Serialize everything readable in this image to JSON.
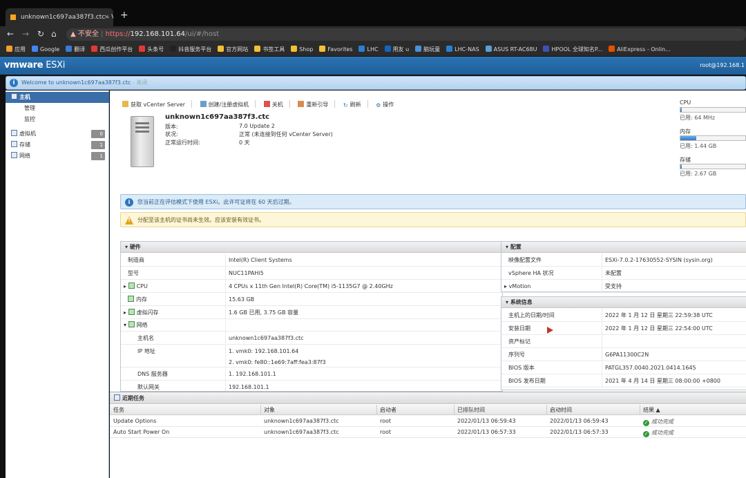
{
  "browser": {
    "tab_title": "unknown1c697aa387f3.ctc - V",
    "tab_close": "×",
    "new_tab": "+",
    "url_warning": "不安全",
    "url_proto": "https://",
    "url_host": "192.168.101.64",
    "url_path": "/ui/#/host",
    "bookmarks": [
      {
        "label": "应用",
        "color": "#f0a030"
      },
      {
        "label": "Google",
        "color": "#4285f4"
      },
      {
        "label": "翻译",
        "color": "#3a7bd5"
      },
      {
        "label": "西瓜创作平台",
        "color": "#e53935"
      },
      {
        "label": "头条号",
        "color": "#e53935"
      },
      {
        "label": "抖音服务平台",
        "color": "#222222"
      },
      {
        "label": "官方网站",
        "color": "#f2c037"
      },
      {
        "label": "书签工具",
        "color": "#f2c037"
      },
      {
        "label": "Shop",
        "color": "#f2c037"
      },
      {
        "label": "Favorites",
        "color": "#f2c037"
      },
      {
        "label": "LHC",
        "color": "#2a7fd4"
      },
      {
        "label": "用友 u",
        "color": "#1565c0"
      },
      {
        "label": "脑玩童",
        "color": "#4a90d9"
      },
      {
        "label": "LHC-NAS",
        "color": "#2a7fd4"
      },
      {
        "label": "ASUS RT-AC68U",
        "color": "#5aa0d8"
      },
      {
        "label": "HPOOL 全球知名P...",
        "color": "#3f51b5"
      },
      {
        "label": "AliExpress - Onlin...",
        "color": "#e65100"
      }
    ]
  },
  "esxi": {
    "logo_vm": "vmware",
    "logo_product": "ESXi",
    "user": "root@192.168.1",
    "welcome": "Welcome to unknown1c697aa387f3.ctc",
    "welcome_close": "- 关闭"
  },
  "sidebar": {
    "items": [
      {
        "label": "主机",
        "badge": ""
      },
      {
        "label": "管理",
        "badge": ""
      },
      {
        "label": "监控",
        "badge": ""
      },
      {
        "label": "虚拟机",
        "badge": "0"
      },
      {
        "label": "存储",
        "badge": "1"
      },
      {
        "label": "网络",
        "badge": "1"
      }
    ]
  },
  "toolbar": {
    "vcenter": "获取 vCenter Server",
    "create_vm": "创建/注册虚拟机",
    "shutdown": "关机",
    "reboot": "重新引导",
    "refresh": "刷新",
    "actions": "操作"
  },
  "host": {
    "name": "unknown1c697aa387f3.ctc",
    "version_label": "版本:",
    "version": "7.0 Update 2",
    "state_label": "状况:",
    "state": "正常 (未连接到任何 vCenter Server)",
    "uptime_label": "正常运行时间:",
    "uptime": "0 天"
  },
  "resources": {
    "cpu": {
      "label": "CPU",
      "used": "已用: 64 MHz",
      "fill": 0.02
    },
    "mem": {
      "label": "内存",
      "used": "已用: 1.44 GB",
      "fill": 0.24
    },
    "storage": {
      "label": "存储",
      "used": "已用: 2.67 GB",
      "fill": 0.02
    }
  },
  "alerts": {
    "eval": "您当前正在评估模式下使用 ESXi。此许可证将在 60 天后过期。",
    "cert": "分配至该主机的证书尚未生效。应该安装有效证书。"
  },
  "hardware": {
    "title": "硬件",
    "rows": [
      {
        "k": "制造商",
        "v": "Intel(R) Client Systems"
      },
      {
        "k": "型号",
        "v": "NUC11PAHi5"
      },
      {
        "k": "CPU",
        "v": "4 CPUs x 11th Gen Intel(R) Core(TM) i5-1135G7 @ 2.40GHz"
      },
      {
        "k": "内存",
        "v": "15.63 GB"
      },
      {
        "k": "虚拟闪存",
        "v": "1.6 GB 已用, 3.75 GB 容量"
      },
      {
        "k": "网络",
        "v": ""
      },
      {
        "k": "主机名",
        "v": "unknown1c697aa387f3.ctc"
      },
      {
        "k": "IP 地址",
        "v": "1. vmk0: 192.168.101.64"
      },
      {
        "k": "",
        "v": "2. vmk0: fe80::1e69:7aff:fea3:87f3"
      },
      {
        "k": "DNS 服务器",
        "v": "1. 192.168.101.1"
      },
      {
        "k": "默认网关",
        "v": "192.168.101.1"
      }
    ]
  },
  "config": {
    "title": "配置",
    "rows": [
      {
        "k": "映像配置文件",
        "v": "ESXi-7.0.2-17630552-SYSIN (sysin.org)"
      },
      {
        "k": "vSphere HA 状况",
        "v": "未配置"
      },
      {
        "k": "vMotion",
        "v": "受支持"
      }
    ]
  },
  "sysinfo": {
    "title": "系统信息",
    "rows": [
      {
        "k": "主机上的日期/时间",
        "v": "2022 年 1 月 12 日 星期三 22:59:38 UTC"
      },
      {
        "k": "安装日期",
        "v": "2022 年 1 月 12 日 星期三 22:54:00 UTC"
      },
      {
        "k": "资产标记",
        "v": ""
      },
      {
        "k": "序列号",
        "v": "G6PA11300C2N"
      },
      {
        "k": "BIOS 版本",
        "v": "PATGL357.0040.2021.0414.1645"
      },
      {
        "k": "BIOS 发布日期",
        "v": "2021 年 4 月 14 日 星期三 08:00:00 +0800"
      }
    ]
  },
  "tasks": {
    "title": "近期任务",
    "headers": [
      "任务",
      "对象",
      "启动者",
      "已排队时间",
      "启动时间",
      "结果 ▲"
    ],
    "rows": [
      [
        "Update Options",
        "unknown1c697aa387f3.ctc",
        "root",
        "2022/01/13 06:59:43",
        "2022/01/13 06:59:43",
        "成功完成"
      ],
      [
        "Auto Start Power On",
        "unknown1c697aa387f3.ctc",
        "root",
        "2022/01/13 06:57:33",
        "2022/01/13 06:57:33",
        "成功完成"
      ]
    ]
  }
}
